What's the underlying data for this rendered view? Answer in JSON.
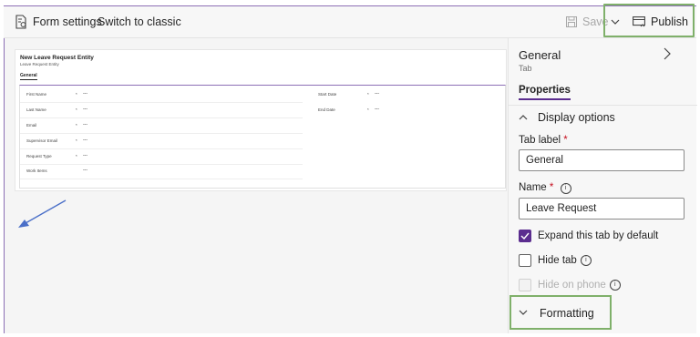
{
  "toolbar": {
    "form_settings": "Form settings",
    "switch_classic": "Switch to classic",
    "save": "Save",
    "publish": "Publish",
    "icons": [
      "form-settings-icon",
      "save-icon",
      "chevron-down-icon",
      "publish-icon"
    ]
  },
  "form": {
    "title": "New Leave Request Entity",
    "subtitle": "Leave Request Entity",
    "tab": "General",
    "left_fields": [
      {
        "label": "First Name",
        "required": "*",
        "value": "---"
      },
      {
        "label": "Last Name",
        "required": "*",
        "value": "---"
      },
      {
        "label": "Email",
        "required": "*",
        "value": "---"
      },
      {
        "label": "Supervisor Email",
        "required": "*",
        "value": "---"
      },
      {
        "label": "Request Type",
        "required": "*",
        "value": "---"
      },
      {
        "label": "Work Items",
        "required": "",
        "value": "---"
      }
    ],
    "right_fields": [
      {
        "label": "Start Date",
        "required": "*",
        "value": "---"
      },
      {
        "label": "End Date",
        "required": "*",
        "value": "---"
      }
    ]
  },
  "panel": {
    "title": "General",
    "subtitle": "Tab",
    "tab": "Properties",
    "display_options": "Display options",
    "tab_label": {
      "label": "Tab label",
      "required": "*",
      "value": "General"
    },
    "name": {
      "label": "Name",
      "required": "*",
      "value": "Leave Request"
    },
    "expand_default": {
      "label": "Expand this tab by default",
      "checked": true
    },
    "hide_tab": {
      "label": "Hide tab",
      "checked": false
    },
    "hide_on_phone": {
      "label": "Hide on phone",
      "checked": false,
      "disabled": true
    },
    "formatting": "Formatting"
  },
  "colors": {
    "accent": "#5b2d8f",
    "highlight_box": "#7fb06a",
    "annotation_arrow": "#4a6fc8"
  }
}
